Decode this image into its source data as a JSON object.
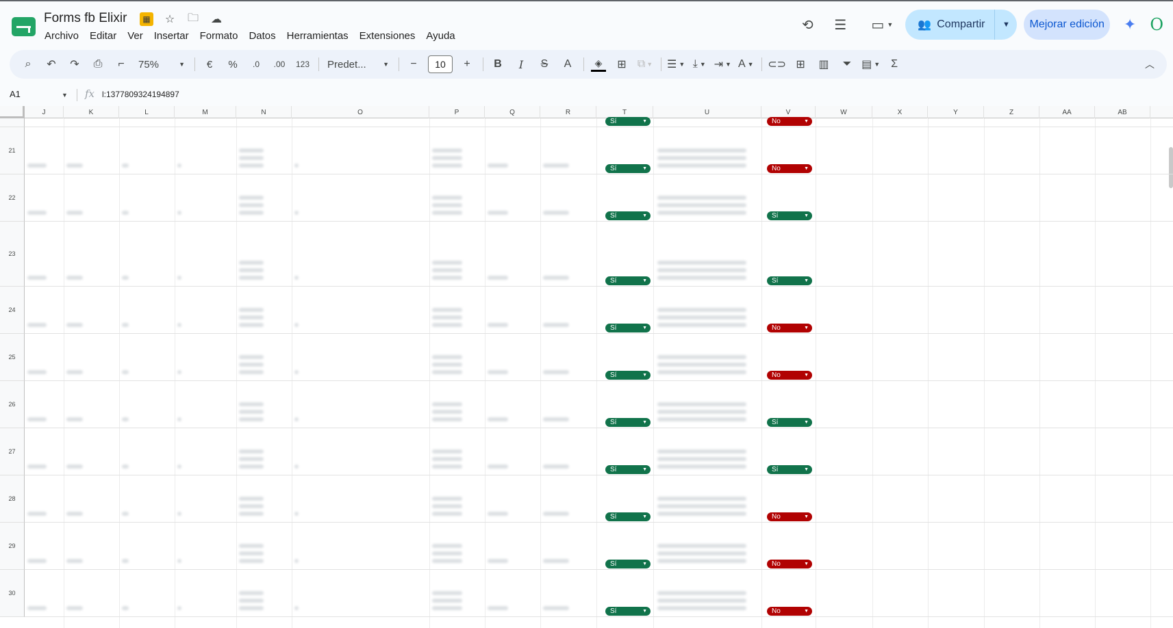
{
  "doc": {
    "title": "Forms fb Elixir"
  },
  "menu": [
    "Archivo",
    "Editar",
    "Ver",
    "Insertar",
    "Formato",
    "Datos",
    "Herramientas",
    "Extensiones",
    "Ayuda"
  ],
  "header_right": {
    "share_label": "Compartir",
    "improve_label": "Mejorar edición"
  },
  "toolbar": {
    "zoom": "75%",
    "currency": "€",
    "percent": "%",
    "dec_less": ".0",
    "dec_more": ".00",
    "num_format": "123",
    "font": "Predet...",
    "font_size": "10",
    "bold": "B",
    "italic": "I",
    "strike": "S",
    "text_color": "A",
    "sigma": "Σ"
  },
  "formula_bar": {
    "cell_ref": "A1",
    "fx": "fx",
    "value": "l:1377809324194897"
  },
  "columns": [
    "J",
    "K",
    "L",
    "M",
    "N",
    "O",
    "P",
    "Q",
    "R",
    "T",
    "U",
    "V",
    "W",
    "X",
    "Y",
    "Z",
    "AA",
    "AB"
  ],
  "rows": [
    {
      "num": "",
      "t": "Sí",
      "v": "No"
    },
    {
      "num": "21",
      "t": "Sí",
      "v": "No"
    },
    {
      "num": "22",
      "t": "Sí",
      "v": "Sí"
    },
    {
      "num": "23",
      "t": "Sí",
      "v": "Sí"
    },
    {
      "num": "24",
      "t": "Sí",
      "v": "No"
    },
    {
      "num": "25",
      "t": "Sí",
      "v": "No"
    },
    {
      "num": "26",
      "t": "Sí",
      "v": "Sí"
    },
    {
      "num": "27",
      "t": "Sí",
      "v": "Sí"
    },
    {
      "num": "28",
      "t": "Sí",
      "v": "No"
    },
    {
      "num": "29",
      "t": "Sí",
      "v": "No"
    },
    {
      "num": "30",
      "t": "Sí",
      "v": "No"
    }
  ],
  "colors": {
    "si": "#11734b",
    "no": "#b10202",
    "share_bg": "#c2e7ff",
    "toolbar_bg": "#edf2fa"
  }
}
